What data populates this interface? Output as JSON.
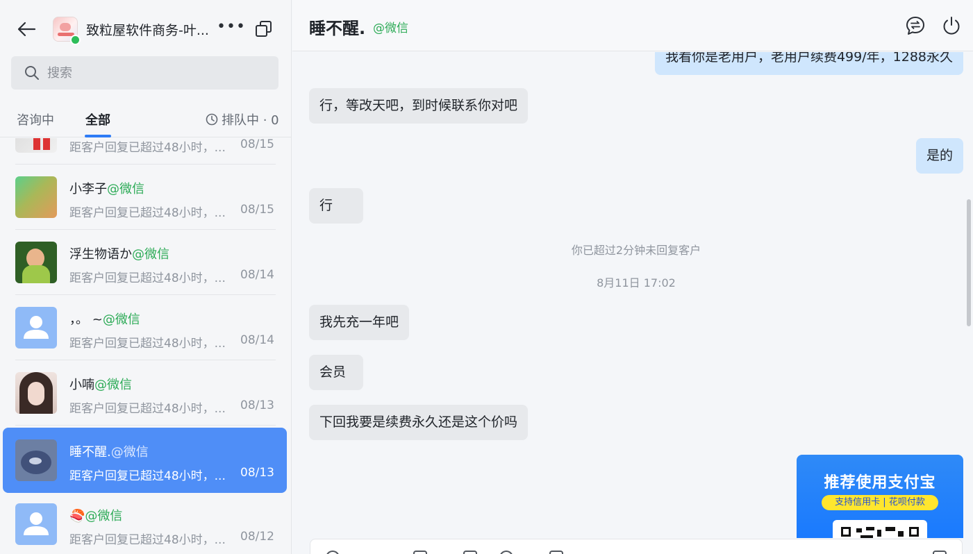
{
  "sidebar": {
    "shop_name": "致粒屋软件商务-叶...",
    "more_label": "•••",
    "search_placeholder": "搜索",
    "tabs": [
      {
        "label": "咨询中"
      },
      {
        "label": "全部"
      }
    ],
    "queue_label": "排队中 · 0",
    "conversations": [
      {
        "name": "",
        "channel": "",
        "preview": "距客户回复已超过48小时，...",
        "date": "08/15"
      },
      {
        "name": "小李子",
        "channel": "@微信",
        "preview": "距客户回复已超过48小时，...",
        "date": "08/15"
      },
      {
        "name": "浮生物语か",
        "channel": "@微信",
        "preview": "距客户回复已超过48小时，...",
        "date": "08/14"
      },
      {
        "name": "，。 ~",
        "channel": "@微信",
        "preview": "距客户回复已超过48小时，...",
        "date": "08/14"
      },
      {
        "name": "小喃",
        "channel": "@微信",
        "preview": "距客户回复已超过48小时，...",
        "date": "08/13"
      },
      {
        "name": "睡不醒.",
        "channel": "@微信",
        "preview": "距客户回复已超过48小时，...",
        "date": "08/13"
      },
      {
        "name": "🍣",
        "channel": "@微信",
        "preview": "距客户回复已超过48小时，...",
        "date": "08/12"
      }
    ]
  },
  "chat": {
    "title": "睡不醒.",
    "channel": "@微信",
    "messages": [
      {
        "side": "out",
        "text": "我看你是老用户，老用户续费499/年，1288永久"
      },
      {
        "side": "in",
        "text": "行，等改天吧，到时候联系你对吧"
      },
      {
        "side": "out",
        "text": "是的"
      },
      {
        "side": "in",
        "text": "行"
      },
      {
        "side": "in",
        "text": "我先充一年吧"
      },
      {
        "side": "in",
        "text": "会员"
      },
      {
        "side": "in",
        "text": "下回我要是续费永久还是这个价吗"
      }
    ],
    "system_notice": "你已超过2分钟未回复客户",
    "timestamp": "8月11日 17:02",
    "promo": {
      "title": "推荐使用支付宝",
      "subtitle": "支持信用卡 | 花呗付款"
    }
  },
  "colors": {
    "accent": "#2e7cf6",
    "active_row": "#4f8ef7",
    "channel_green": "#2dab57",
    "online": "#2dbd5a",
    "out_bubble": "#cfe6fd",
    "in_bubble": "#e7e9ec"
  }
}
